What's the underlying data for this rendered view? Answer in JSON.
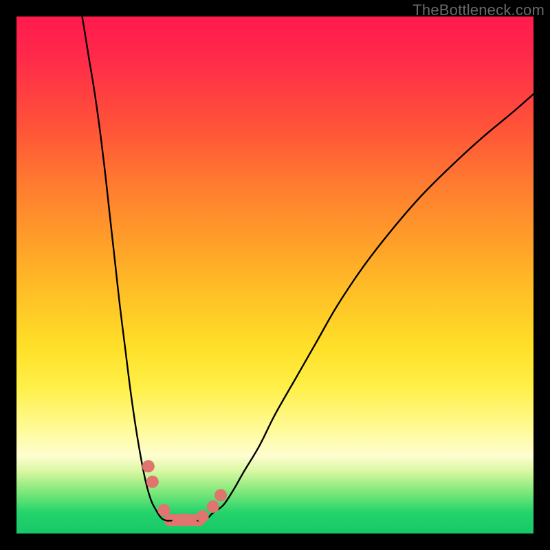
{
  "watermark": "TheBottleneck.com",
  "chart_data": {
    "type": "line",
    "title": "",
    "xlabel": "",
    "ylabel": "",
    "xlim": [
      0,
      100
    ],
    "ylim": [
      0,
      100
    ],
    "right_arm": {
      "x": [
        35,
        36,
        37,
        38,
        40,
        42,
        44,
        47,
        50,
        54,
        58,
        62,
        67,
        72,
        78,
        84,
        90,
        96,
        100
      ],
      "y": [
        2.5,
        2.5,
        3,
        4,
        5.5,
        8.5,
        12,
        17,
        23,
        30,
        37,
        44,
        51.5,
        58,
        65,
        71,
        76.5,
        81.5,
        85
      ]
    },
    "left_arm": {
      "x": [
        30,
        29,
        28,
        27,
        26,
        25,
        24,
        23,
        22,
        21,
        20,
        19,
        18,
        17,
        16,
        15,
        14,
        13.2,
        12.7
      ],
      "y": [
        2.5,
        2.5,
        3,
        4.5,
        6.5,
        10,
        15,
        21,
        28,
        36,
        44,
        53,
        62,
        71,
        79,
        86,
        92,
        97,
        100
      ]
    },
    "annotations": {
      "highlight_dots": [
        {
          "x": 25.5,
          "y": 13
        },
        {
          "x": 26.3,
          "y": 10
        },
        {
          "x": 28.5,
          "y": 4.5
        },
        {
          "x": 32.5,
          "y": 2.7
        },
        {
          "x": 36.0,
          "y": 3.3
        },
        {
          "x": 38.0,
          "y": 5.2
        },
        {
          "x": 39.5,
          "y": 7.4
        }
      ],
      "highlight_band": {
        "from_x": 28.5,
        "to_x": 36.5,
        "y": 2.6
      },
      "dot_color": "#e0746f",
      "dot_radius_px": 9
    }
  }
}
